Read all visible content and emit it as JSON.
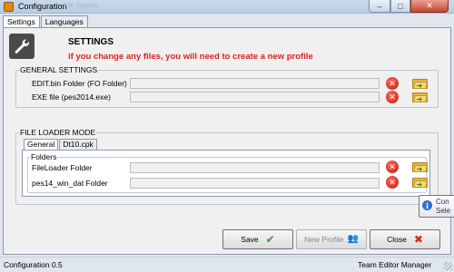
{
  "window": {
    "title": "Configuration",
    "ghost_menu": "File        Options",
    "minimize_symbol": "–",
    "maximize_symbol": "□",
    "close_symbol": "✕"
  },
  "tabs": [
    "Settings",
    "Languages"
  ],
  "header": {
    "title": "SETTINGS",
    "warning": "if you change any files, you will need to create a new profile"
  },
  "general_settings": {
    "title": "GENERAL SETTINGS",
    "rows": [
      {
        "label": "EDIT.bin Folder (FO Folder)",
        "value": ""
      },
      {
        "label": "EXE file (pes2014.exe)",
        "value": ""
      }
    ]
  },
  "file_loader": {
    "title": "FILE LOADER MODE",
    "tabs": [
      "General",
      "Dt10.cpk"
    ],
    "folders_title": "Folders",
    "rows": [
      {
        "label": "FileLoader Folder",
        "value": ""
      },
      {
        "label": "pes14_win_dat Folder",
        "value": ""
      }
    ]
  },
  "buttons": {
    "save": "Save",
    "new_profile": "New Profile",
    "close": "Close"
  },
  "tooltip": {
    "line1": "Con",
    "line2": "Sele"
  },
  "statusbar": {
    "version": "Configuration 0.5",
    "credit": "Team Editor Manager"
  },
  "colors": {
    "warning": "#e02020",
    "save_check": "#2f9a2f",
    "close_x": "#d42a1c"
  },
  "icons": [
    "wrench-icon",
    "clear-x-icon",
    "browse-folder-icon",
    "check-icon",
    "people-icon",
    "close-x-icon",
    "info-icon"
  ]
}
